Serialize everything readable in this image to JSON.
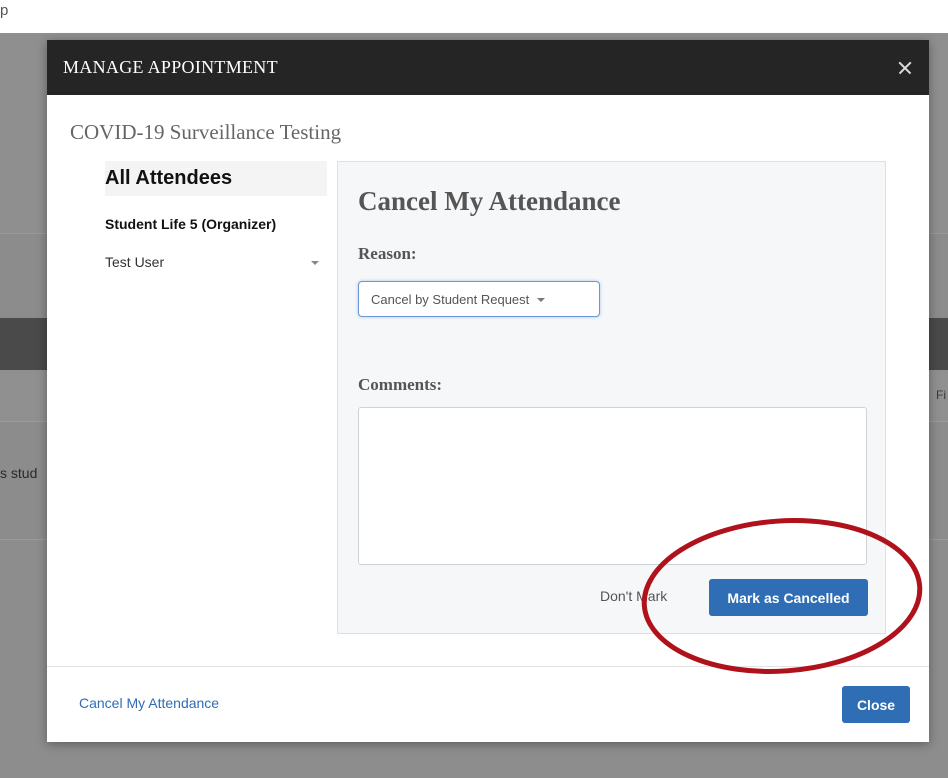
{
  "background": {
    "top_text": "p",
    "left_text": "s stud",
    "right_text": "Fi"
  },
  "modal": {
    "title": "MANAGE APPOINTMENT",
    "event_title": "COVID-19 Surveillance Testing",
    "close_icon": "close-icon"
  },
  "attendees": {
    "heading": "All Attendees",
    "organizer": "Student Life 5 (Organizer)",
    "items": [
      {
        "name": "Test User"
      }
    ]
  },
  "cancel_panel": {
    "title": "Cancel My Attendance",
    "reason_label": "Reason:",
    "reason_value": "Cancel by Student Request",
    "comments_label": "Comments:",
    "comments_value": "",
    "dont_mark_label": "Don't Mark",
    "mark_button_label": "Mark as Cancelled"
  },
  "footer": {
    "cancel_link": "Cancel My Attendance",
    "close_button": "Close"
  },
  "colors": {
    "header_bg": "#252525",
    "accent_blue": "#2f6db5",
    "highlight_red": "#b0121c"
  }
}
